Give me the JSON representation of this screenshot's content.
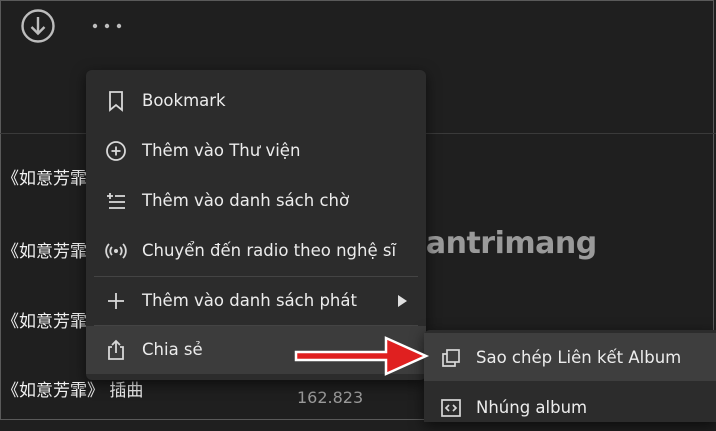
{
  "topbar": {
    "download_icon": "download-circle-icon",
    "more_icon": "more-horizontal-icon"
  },
  "tracks": [
    {
      "title": "《如意芳霏"
    },
    {
      "title": "《如意芳霏"
    },
    {
      "title": "《如意芳霏"
    },
    {
      "title": "《如意芳霏》 插曲"
    }
  ],
  "play_count": "162.823",
  "context_menu": {
    "items": [
      {
        "label": "Bookmark",
        "icon": "bookmark-icon"
      },
      {
        "label": "Thêm vào Thư viện",
        "icon": "add-circle-icon"
      },
      {
        "label": "Thêm vào danh sách chờ",
        "icon": "queue-add-icon"
      },
      {
        "label": "Chuyển đến radio theo nghệ sĩ",
        "icon": "radio-icon"
      },
      {
        "label": "Thêm vào danh sách phát",
        "icon": "plus-icon",
        "has_submenu": true
      },
      {
        "label": "Chia sẻ",
        "icon": "share-icon",
        "has_submenu": true,
        "active": true
      }
    ]
  },
  "share_submenu": {
    "items": [
      {
        "label": "Sao chép Liên kết Album",
        "icon": "copy-icon",
        "active": true
      },
      {
        "label": "Nhúng album",
        "icon": "embed-icon"
      }
    ]
  },
  "watermark": {
    "text": "uantrimang"
  },
  "colors": {
    "background": "#1f1f1f",
    "menu": "#2c2c2c",
    "annotation_arrow": "#e02020"
  }
}
